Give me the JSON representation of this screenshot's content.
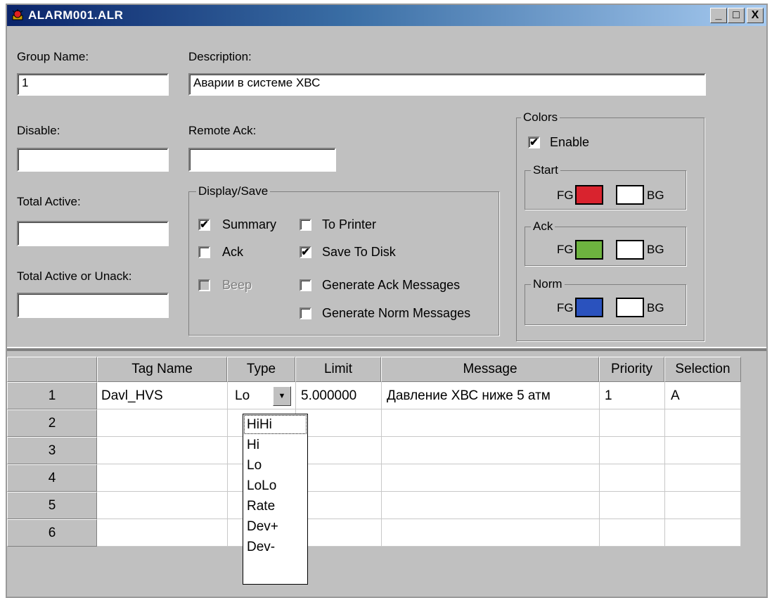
{
  "window": {
    "title": "ALARM001.ALR"
  },
  "title_buttons": {
    "minimize": "_",
    "maximize": "□",
    "close": "X"
  },
  "form": {
    "group_name_label": "Group Name:",
    "group_name_value": "1",
    "description_label": "Description:",
    "description_value": "Аварии в системе ХВС",
    "disable_label": "Disable:",
    "disable_value": "",
    "remote_ack_label": "Remote Ack:",
    "remote_ack_value": "",
    "total_active_label": "Total Active:",
    "total_active_value": "",
    "total_active_unack_label": "Total Active or Unack:",
    "total_active_unack_value": ""
  },
  "display_save": {
    "legend": "Display/Save",
    "summary": {
      "label": "Summary",
      "checked": true
    },
    "to_printer": {
      "label": "To Printer",
      "checked": false
    },
    "ack": {
      "label": "Ack",
      "checked": false
    },
    "save_to_disk": {
      "label": "Save To Disk",
      "checked": true
    },
    "beep": {
      "label": "Beep",
      "checked": false,
      "disabled": true
    },
    "gen_ack": {
      "label": "Generate Ack Messages",
      "checked": false
    },
    "gen_norm": {
      "label": "Generate Norm Messages",
      "checked": false
    }
  },
  "colors": {
    "legend": "Colors",
    "enable": {
      "label": "Enable",
      "checked": true
    },
    "fg_label": "FG",
    "bg_label": "BG",
    "start": {
      "legend": "Start",
      "fg": "#d9232e",
      "bg": "#ffffff"
    },
    "ack": {
      "legend": "Ack",
      "fg": "#6db33f",
      "bg": "#ffffff"
    },
    "norm": {
      "legend": "Norm",
      "fg": "#2a52be",
      "bg": "#ffffff"
    }
  },
  "grid": {
    "columns": [
      "Tag Name",
      "Type",
      "Limit",
      "Message",
      "Priority",
      "Selection"
    ],
    "row_numbers": [
      "1",
      "2",
      "3",
      "4",
      "5",
      "6"
    ],
    "rows": [
      {
        "tag": "Davl_HVS",
        "type": "Lo",
        "limit": "5.000000",
        "message": "Давление ХВС ниже 5 атм",
        "priority": "1",
        "selection": "A"
      }
    ],
    "dropdown_arrow": "▼",
    "type_options": [
      "HiHi",
      "Hi",
      "Lo",
      "LoLo",
      "Rate",
      "Dev+",
      "Dev-"
    ]
  },
  "check_mark": "✔"
}
